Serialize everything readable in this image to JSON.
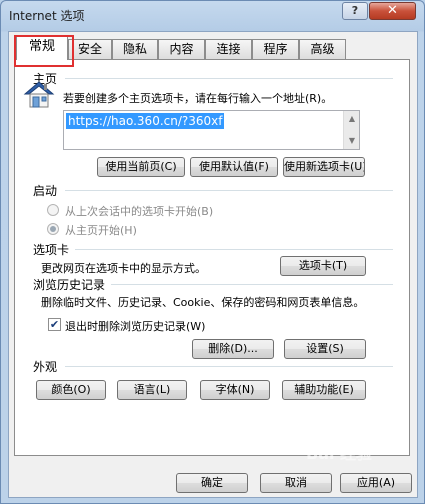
{
  "window": {
    "title": "Internet 选项",
    "help": "?",
    "close": "✕"
  },
  "tabs": [
    "常规",
    "安全",
    "隐私",
    "内容",
    "连接",
    "程序",
    "高级"
  ],
  "home": {
    "section": "主页",
    "description": "若要创建多个主页选项卡，请在每行输入一个地址(R)。",
    "url": "https://hao.360.cn/?360xf",
    "buttons": [
      "使用当前页(C)",
      "使用默认值(F)",
      "使用新选项卡(U)"
    ]
  },
  "startup": {
    "section": "启动",
    "option1": "从上次会话中的选项卡开始(B)",
    "option2": "从主页开始(H)"
  },
  "tabsection": {
    "section": "选项卡",
    "description": "更改网页在选项卡中的显示方式。",
    "button": "选项卡(T)"
  },
  "history": {
    "section": "浏览历史记录",
    "description": "删除临时文件、历史记录、Cookie、保存的密码和网页表单信息。",
    "checkbox_label": "退出时删除浏览历史记录(W)",
    "checked": true,
    "delete_button": "删除(D)...",
    "settings_button": "设置(S)"
  },
  "appearance": {
    "section": "外观",
    "buttons": [
      "颜色(O)",
      "语言(L)",
      "字体(N)",
      "辅助功能(E)"
    ]
  },
  "footer": {
    "ok": "确定",
    "cancel": "取消",
    "apply": "应用(A)"
  },
  "watermark": "Bai 经验"
}
